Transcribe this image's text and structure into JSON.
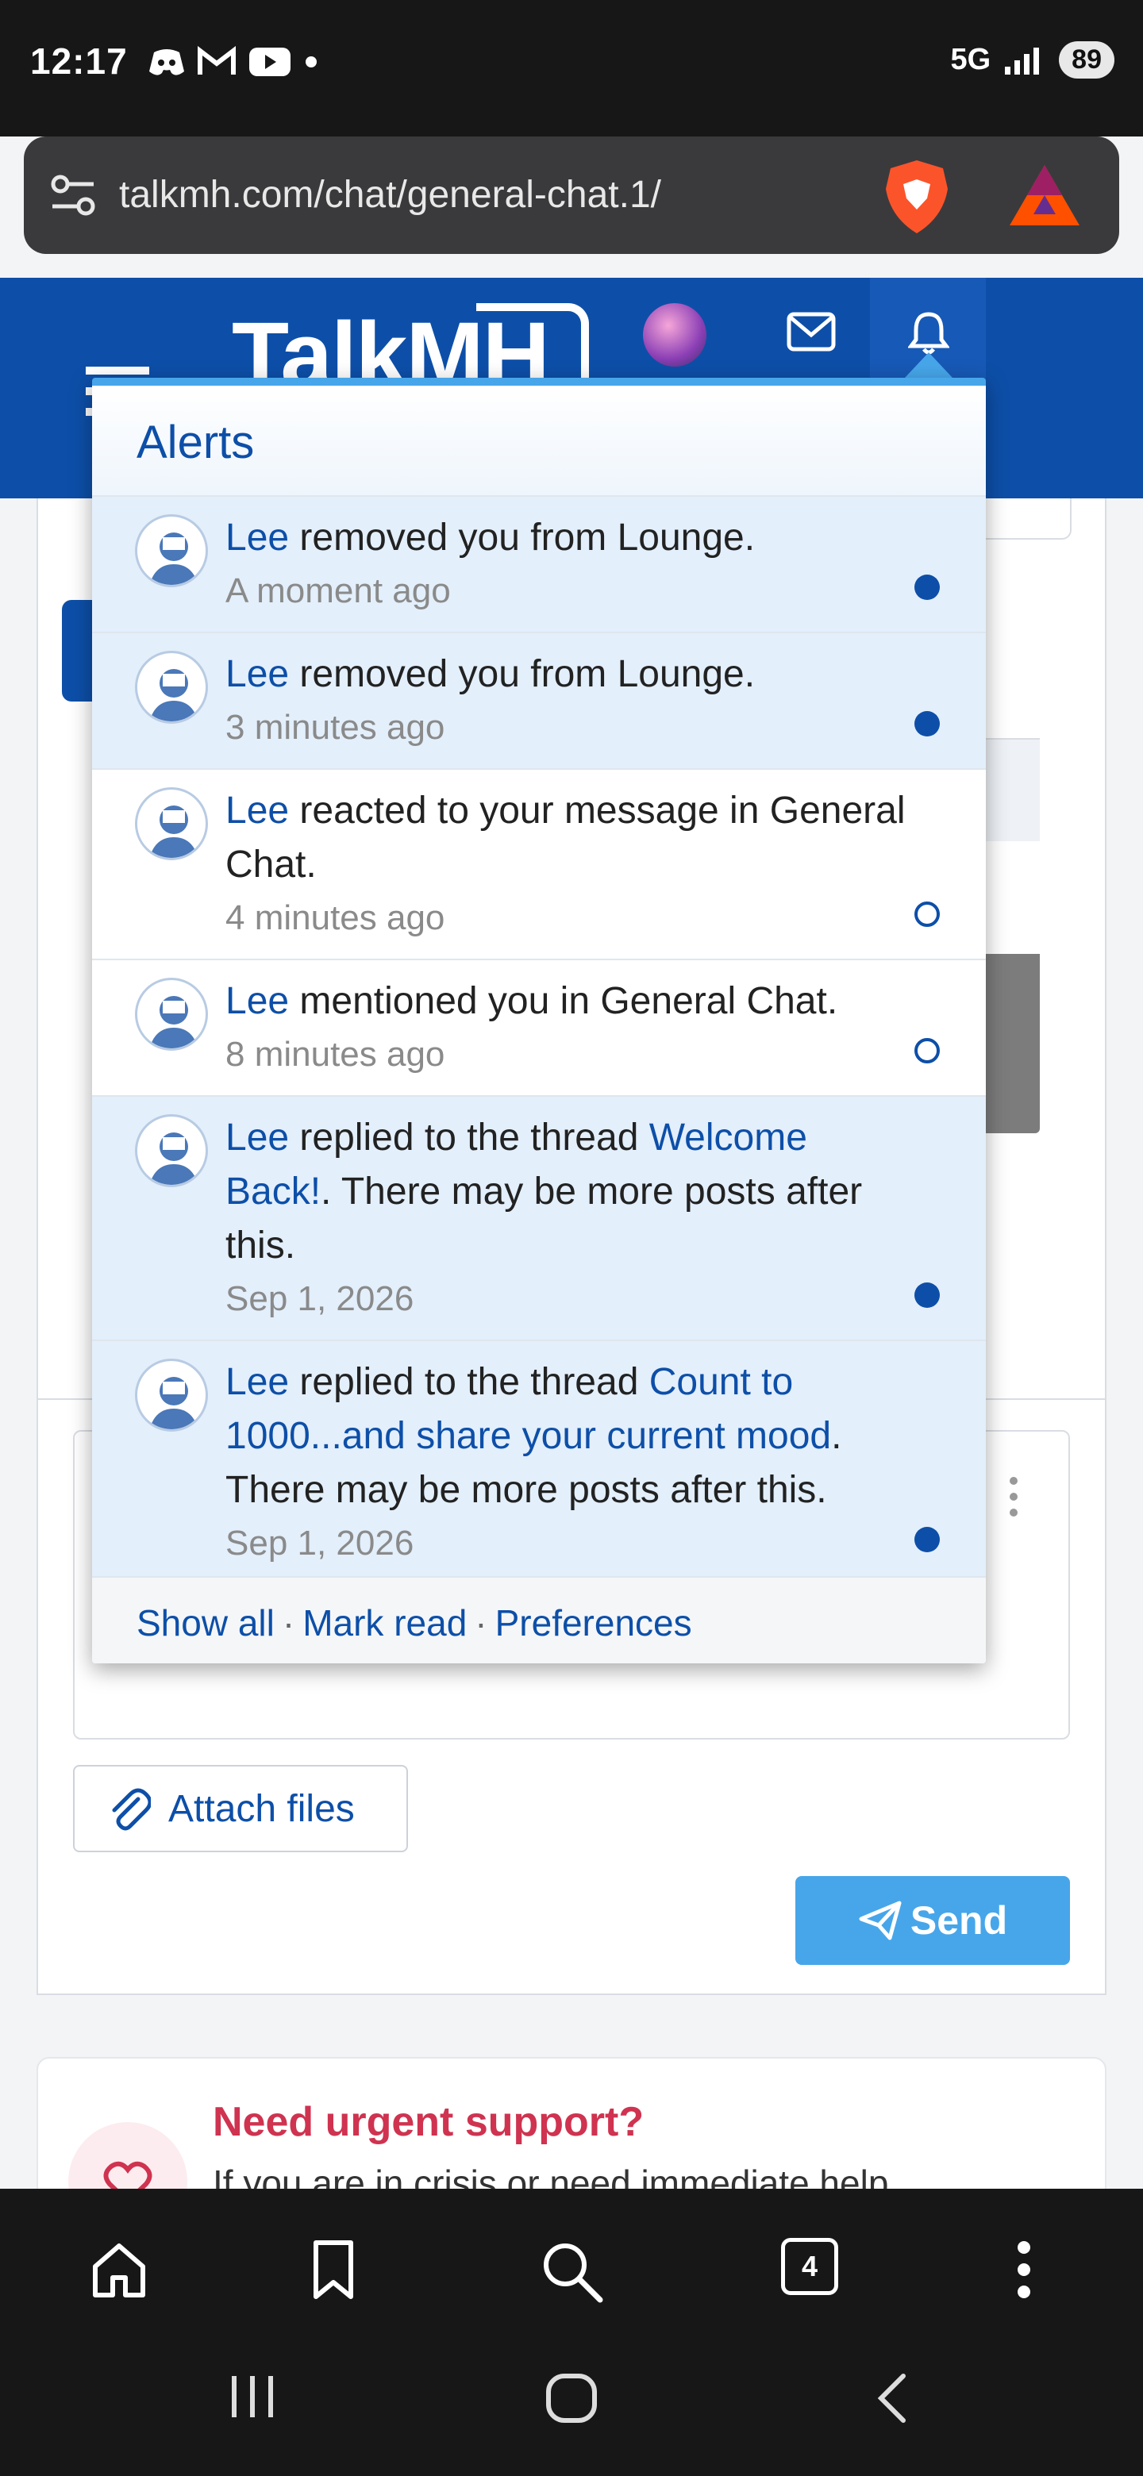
{
  "status_bar": {
    "time": "12:17",
    "network": "5G",
    "battery": "89"
  },
  "browser": {
    "url": "talkmh.com/chat/general-chat.1/",
    "tab_count": "4"
  },
  "site": {
    "logo": "TalkMH"
  },
  "alerts": {
    "title": "Alerts",
    "items": [
      {
        "user": "Lee",
        "text": " removed you from Lounge.",
        "time": "A moment ago",
        "read": false
      },
      {
        "user": "Lee",
        "text": " removed you from Lounge.",
        "time": "3 minutes ago",
        "read": false
      },
      {
        "user": "Lee",
        "text": " reacted to your message in General Chat.",
        "time": "4 minutes ago",
        "read": true
      },
      {
        "user": "Lee",
        "text": " mentioned you in General Chat.",
        "time": "8 minutes ago",
        "read": true
      },
      {
        "user": "Lee",
        "pre": " replied to the thread ",
        "link": "Welcome Back!",
        "post": ". There may be more posts after this.",
        "time": "Sep 1, 2026",
        "read": false
      },
      {
        "user": "Lee",
        "pre": " replied to the thread ",
        "link": "Count to 1000...and share your current mood",
        "post": ". There may be more posts after this.",
        "time": "Sep 1, 2026",
        "read": false
      }
    ],
    "footer": {
      "show_all": "Show all",
      "mark_read": "Mark read",
      "preferences": "Preferences",
      "separator": "·"
    }
  },
  "composer": {
    "attach_label": "Attach files",
    "send_label": "Send"
  },
  "support": {
    "title": "Need urgent support?",
    "text": "If you are in crisis or need immediate help"
  },
  "colors": {
    "brand_blue": "#0d4fa8",
    "accent_blue": "#47a6ea",
    "unread_bg": "#e3effb",
    "support_red": "#cf3350"
  }
}
